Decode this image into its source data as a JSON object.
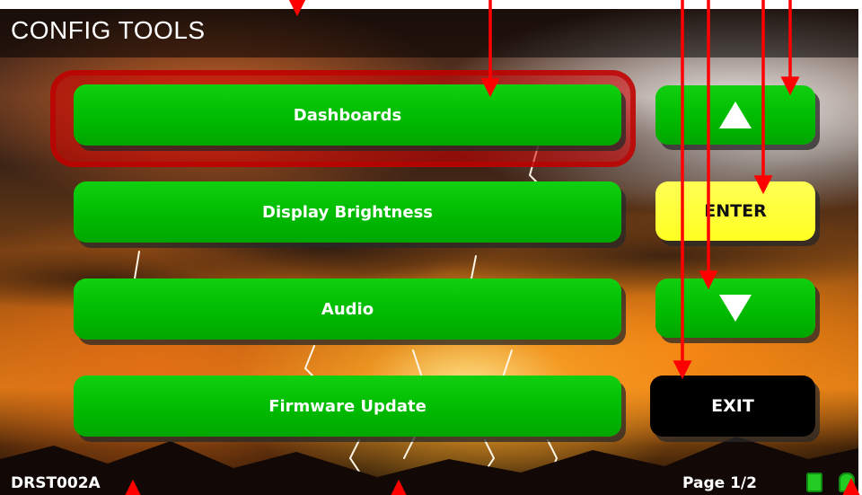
{
  "title": "CONFIG TOOLS",
  "menu": {
    "items": [
      {
        "label": "Dashboards",
        "selected": true
      },
      {
        "label": "Display Brightness",
        "selected": false
      },
      {
        "label": "Audio",
        "selected": false
      },
      {
        "label": "Firmware Update",
        "selected": false
      }
    ]
  },
  "controls": {
    "up_icon": "arrow-up-icon",
    "enter_label": "ENTER",
    "down_icon": "arrow-down-icon",
    "exit_label": "EXIT"
  },
  "footer": {
    "device_id": "DRST002A",
    "page": "Page 1/2",
    "status_icons": [
      "memory-card-icon",
      "sd-card-icon"
    ]
  },
  "colors": {
    "button_green": "#00bb00",
    "enter_yellow": "#ffff33",
    "exit_black": "#000000",
    "selection_red": "#cc0000",
    "annotation_red": "#ff0000"
  }
}
